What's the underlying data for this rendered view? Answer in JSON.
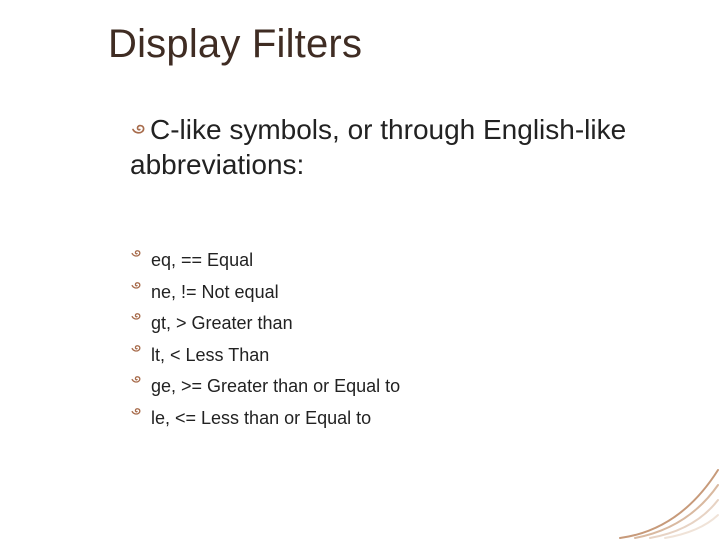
{
  "title": "Display Filters",
  "intro": "C-like symbols, or through English-like abbreviations:",
  "items": [
    "eq, == Equal",
    "ne, != Not equal",
    "gt, > Greater than",
    "lt, < Less Than",
    "ge, >= Greater than or Equal to",
    "le, <= Less than or Equal to"
  ],
  "colors": {
    "title": "#3f2c23",
    "bullet": "#a76b4b",
    "text": "#222222"
  }
}
